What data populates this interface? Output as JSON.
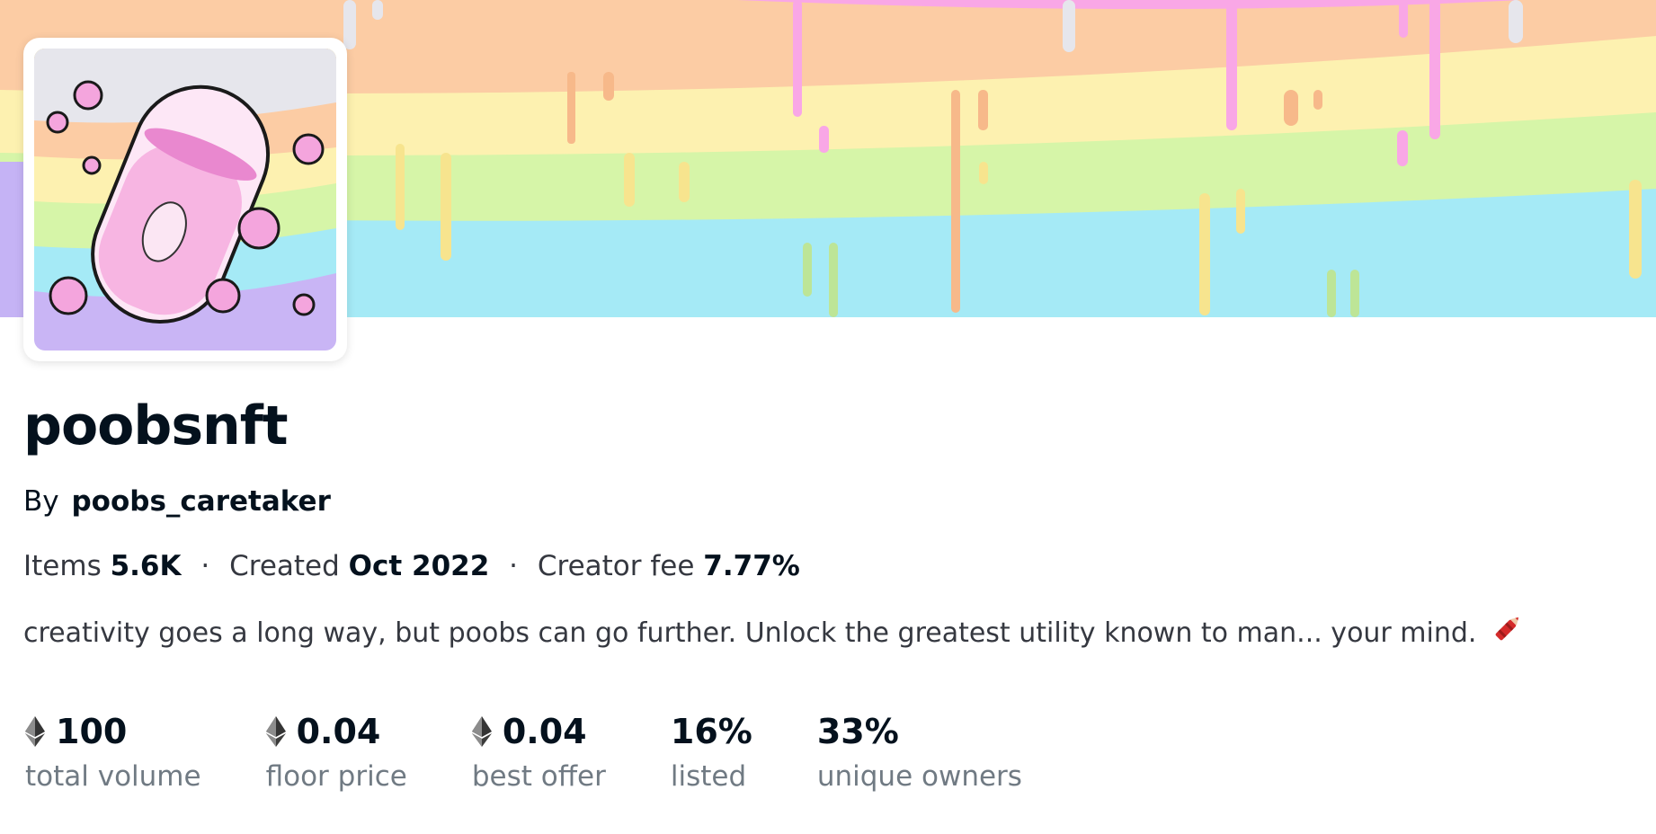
{
  "collection": {
    "name": "poobsnft",
    "by_prefix": "By",
    "creator": "poobs_caretaker",
    "meta": {
      "items_label": "Items",
      "items_value": "5.6K",
      "created_label": "Created",
      "created_value": "Oct 2022",
      "fee_label": "Creator fee",
      "fee_value": "7.77%",
      "separator": "·"
    },
    "description": "creativity goes a long way, but poobs can go further. Unlock the greatest utility known to man... your mind."
  },
  "stats": [
    {
      "value": "100",
      "label": "total volume",
      "icon": "ethereum-icon"
    },
    {
      "value": "0.04",
      "label": "floor price",
      "icon": "ethereum-icon"
    },
    {
      "value": "0.04",
      "label": "best offer",
      "icon": "ethereum-icon"
    },
    {
      "value": "16%",
      "label": "listed",
      "icon": ""
    },
    {
      "value": "33%",
      "label": "unique owners",
      "icon": ""
    }
  ],
  "icons": {
    "description_emoji": "crayon-icon"
  },
  "colors": {
    "text_primary": "#04111d",
    "text_secondary": "#707a83",
    "banner_orange": "#fccca4",
    "banner_yellow": "#fdf1b0",
    "banner_green": "#d6f5a8",
    "banner_blue": "#a5eaf6",
    "banner_pink": "#f9a7e6"
  }
}
